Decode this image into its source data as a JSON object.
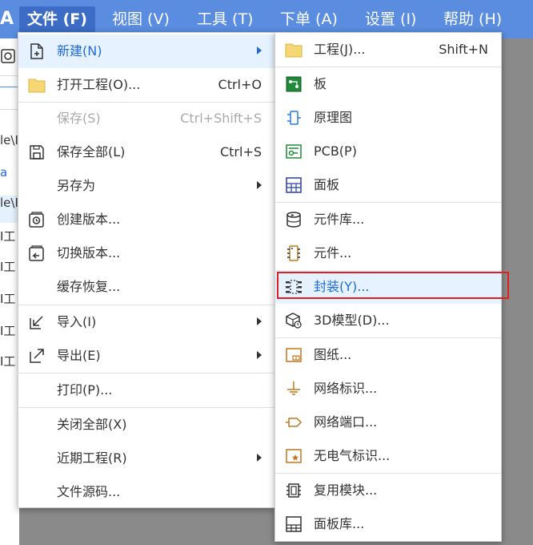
{
  "menubar": {
    "logo": "A",
    "items": [
      "文件 (F)",
      "视图 (V)",
      "工具 (T)",
      "下单 (A)",
      "设置 (I)",
      "帮助 (H)"
    ]
  },
  "left_pane": {
    "texts": [
      "le\\I",
      "a",
      "le\\I",
      "I工",
      "I工",
      "I工",
      "I工",
      "I工"
    ]
  },
  "file_menu": {
    "items": [
      {
        "label": "新建(N)",
        "shortcut": "",
        "icon": "new-file-icon"
      },
      {
        "label": "打开工程(O)...",
        "shortcut": "Ctrl+O",
        "icon": "folder-icon"
      },
      {
        "label": "保存(S)",
        "shortcut": "Ctrl+Shift+S",
        "icon": ""
      },
      {
        "label": "保存全部(L)",
        "shortcut": "Ctrl+S",
        "icon": "save-icon"
      },
      {
        "label": "另存为",
        "shortcut": "",
        "icon": ""
      },
      {
        "label": "创建版本...",
        "shortcut": "",
        "icon": "create-version-icon"
      },
      {
        "label": "切换版本...",
        "shortcut": "",
        "icon": "switch-version-icon"
      },
      {
        "label": "缓存恢复...",
        "shortcut": "",
        "icon": ""
      },
      {
        "label": "导入(I)",
        "shortcut": "",
        "icon": "import-icon"
      },
      {
        "label": "导出(E)",
        "shortcut": "",
        "icon": "export-icon"
      },
      {
        "label": "打印(P)...",
        "shortcut": "",
        "icon": ""
      },
      {
        "label": "关闭全部(X)",
        "shortcut": "",
        "icon": ""
      },
      {
        "label": "近期工程(R)",
        "shortcut": "",
        "icon": ""
      },
      {
        "label": "文件源码...",
        "shortcut": "",
        "icon": ""
      }
    ]
  },
  "new_menu": {
    "items": [
      {
        "label": "工程(J)...",
        "shortcut": "Shift+N",
        "icon": "project-folder-icon"
      },
      {
        "label": "板",
        "shortcut": "",
        "icon": "board-icon"
      },
      {
        "label": "原理图",
        "shortcut": "",
        "icon": "schematic-icon"
      },
      {
        "label": "PCB(P)",
        "shortcut": "",
        "icon": "pcb-icon"
      },
      {
        "label": "面板",
        "shortcut": "",
        "icon": "panel-icon"
      },
      {
        "label": "元件库...",
        "shortcut": "",
        "icon": "component-library-icon"
      },
      {
        "label": "元件...",
        "shortcut": "",
        "icon": "component-icon"
      },
      {
        "label": "封装(Y)...",
        "shortcut": "",
        "icon": "footprint-icon"
      },
      {
        "label": "3D模型(D)...",
        "shortcut": "",
        "icon": "3d-model-icon"
      },
      {
        "label": "图纸...",
        "shortcut": "",
        "icon": "drawing-sheet-icon"
      },
      {
        "label": "网络标识...",
        "shortcut": "",
        "icon": "net-label-icon"
      },
      {
        "label": "网络端口...",
        "shortcut": "",
        "icon": "net-port-icon"
      },
      {
        "label": "无电气标识...",
        "shortcut": "",
        "icon": "no-electrical-icon"
      },
      {
        "label": "复用模块...",
        "shortcut": "",
        "icon": "reuse-block-icon"
      },
      {
        "label": "面板库...",
        "shortcut": "",
        "icon": "panel-library-icon"
      }
    ]
  },
  "colors": {
    "menubar": "#5a8de0",
    "active": "#3c6cc6",
    "highlight": "#1e6bd9",
    "annotation": "#e02020"
  }
}
